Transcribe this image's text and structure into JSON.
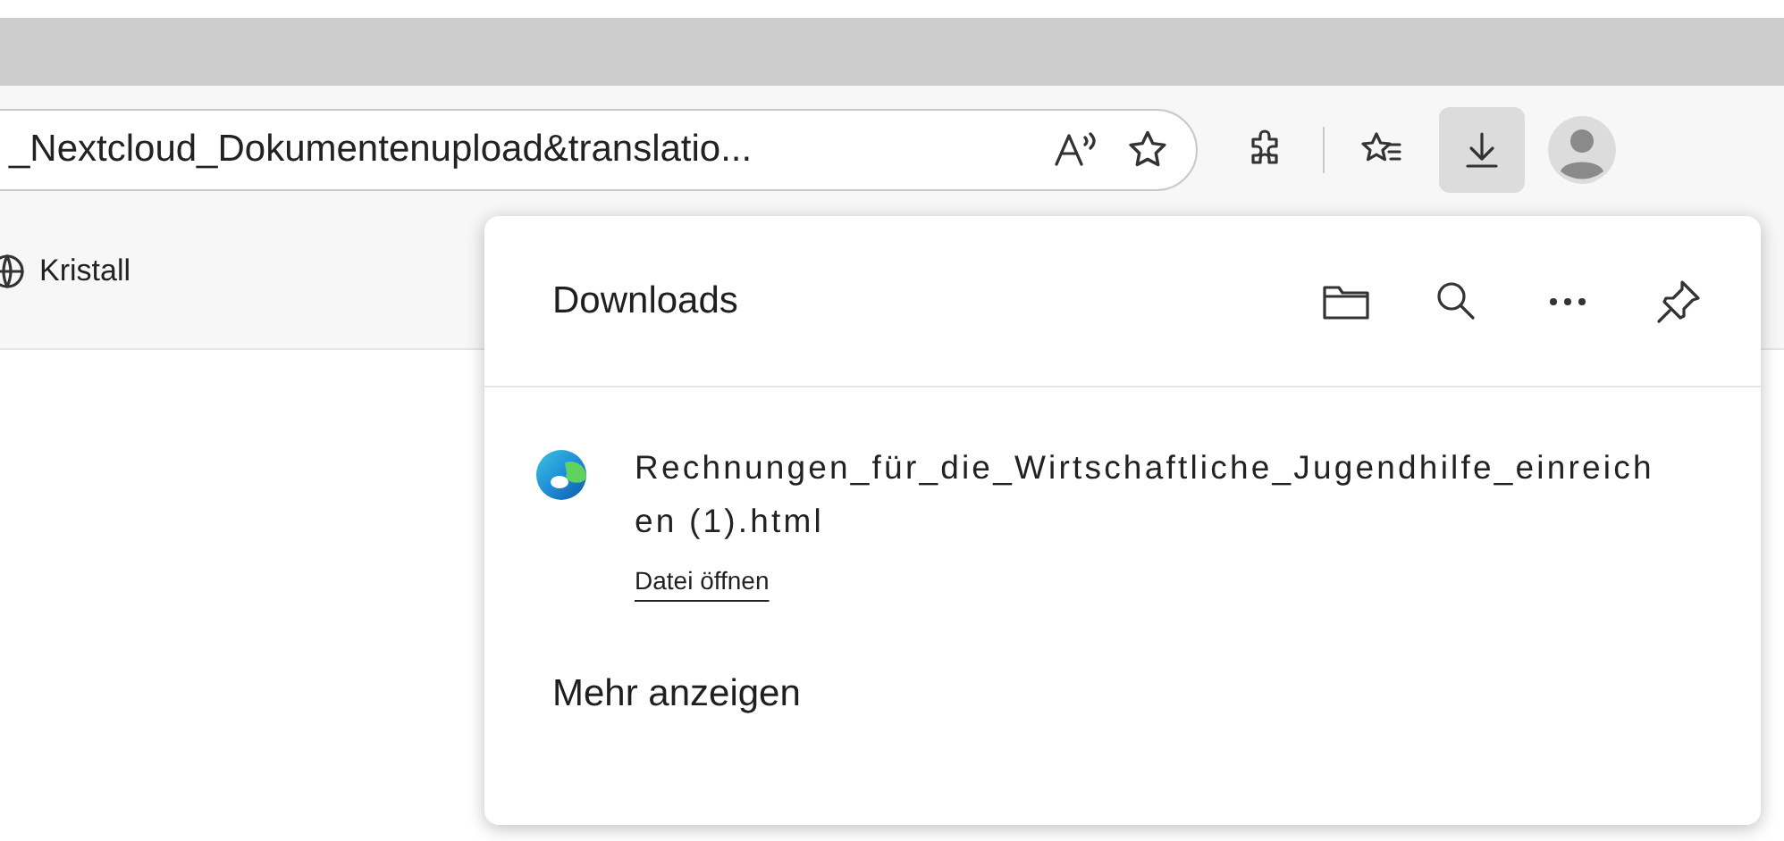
{
  "address_bar": {
    "url": "_Nextcloud_Dokumentenupload&translatio..."
  },
  "toolbar": {
    "buttons": [
      {
        "kind": "extensions",
        "selected": false
      },
      {
        "kind": "favorites",
        "selected": false
      },
      {
        "kind": "downloads",
        "selected": true
      },
      {
        "kind": "profile",
        "selected": false
      }
    ]
  },
  "bookmarks": [
    {
      "label": "Kristall"
    }
  ],
  "downloads_panel": {
    "title": "Downloads",
    "items": [
      {
        "filename": "Rechnungen_für_die_Wirtschaftliche_Jugendhilfe_einreichen (1).html",
        "action": "Datei öffnen"
      }
    ],
    "more": "Mehr anzeigen"
  }
}
